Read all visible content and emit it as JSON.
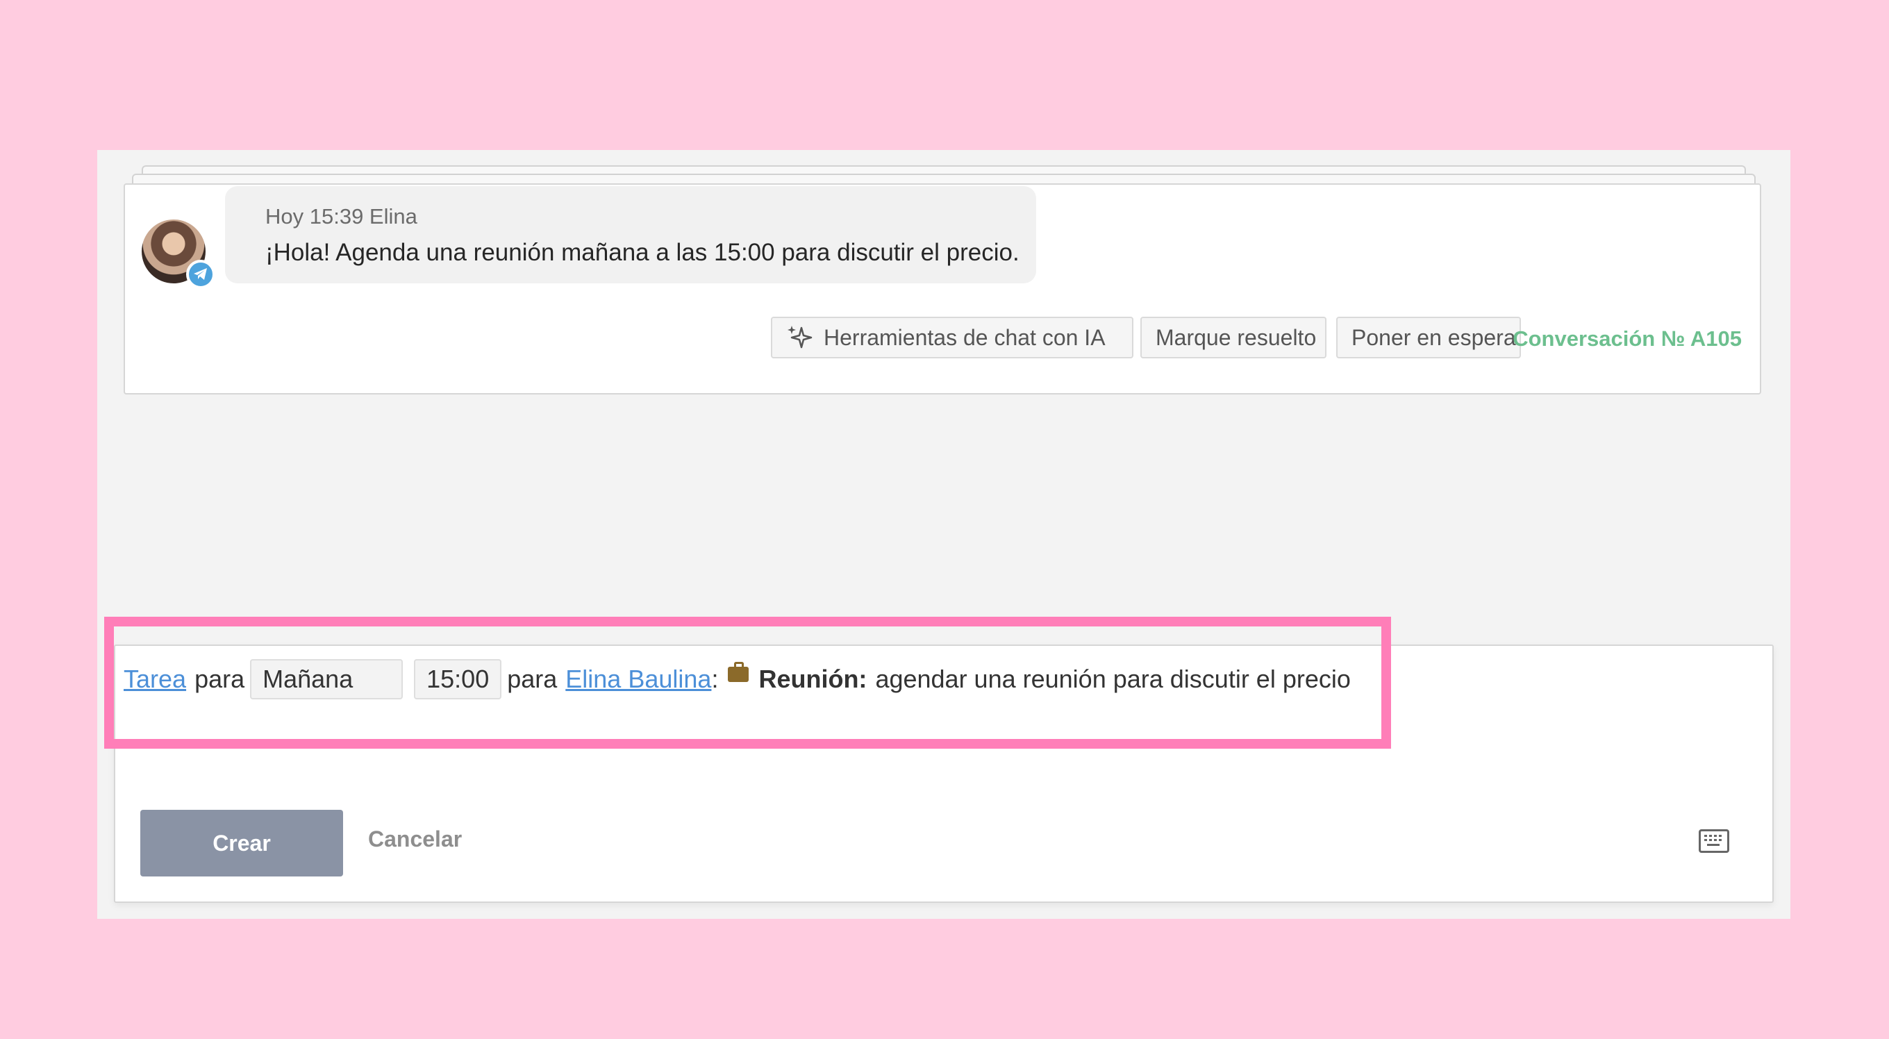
{
  "message": {
    "meta": "Hoy 15:39 Elina",
    "text": "¡Hola! Agenda una reunión mañana a las 15:00 para discutir el precio."
  },
  "actions": {
    "ai_tools_label": "Herramientas de chat con IA",
    "resolve_label": "Marque resuelto",
    "hold_label": "Poner en espera",
    "conversation_id": "Conversación № A105"
  },
  "task": {
    "type_link": "Tarea",
    "para1": "para",
    "date_value": "Mañana",
    "time_value": "15:00",
    "para2": "para",
    "assignee_link": "Elina Baulina",
    "colon": ":",
    "category": "Reunión:",
    "description": "agendar una reunión para discutir el precio"
  },
  "composer": {
    "create_label": "Crear",
    "cancel_label": "Cancelar"
  },
  "icons": {
    "channel_badge": "telegram-icon",
    "ai_tools": "sparkle-icon",
    "category": "briefcase-icon",
    "keyboard": "keyboard-icon"
  },
  "colors": {
    "background": "#ffcce0",
    "highlight": "#ff7eb8",
    "link": "#4c8fd8",
    "conversation_id": "#6cbf8e",
    "create_button": "#8a93a5"
  }
}
